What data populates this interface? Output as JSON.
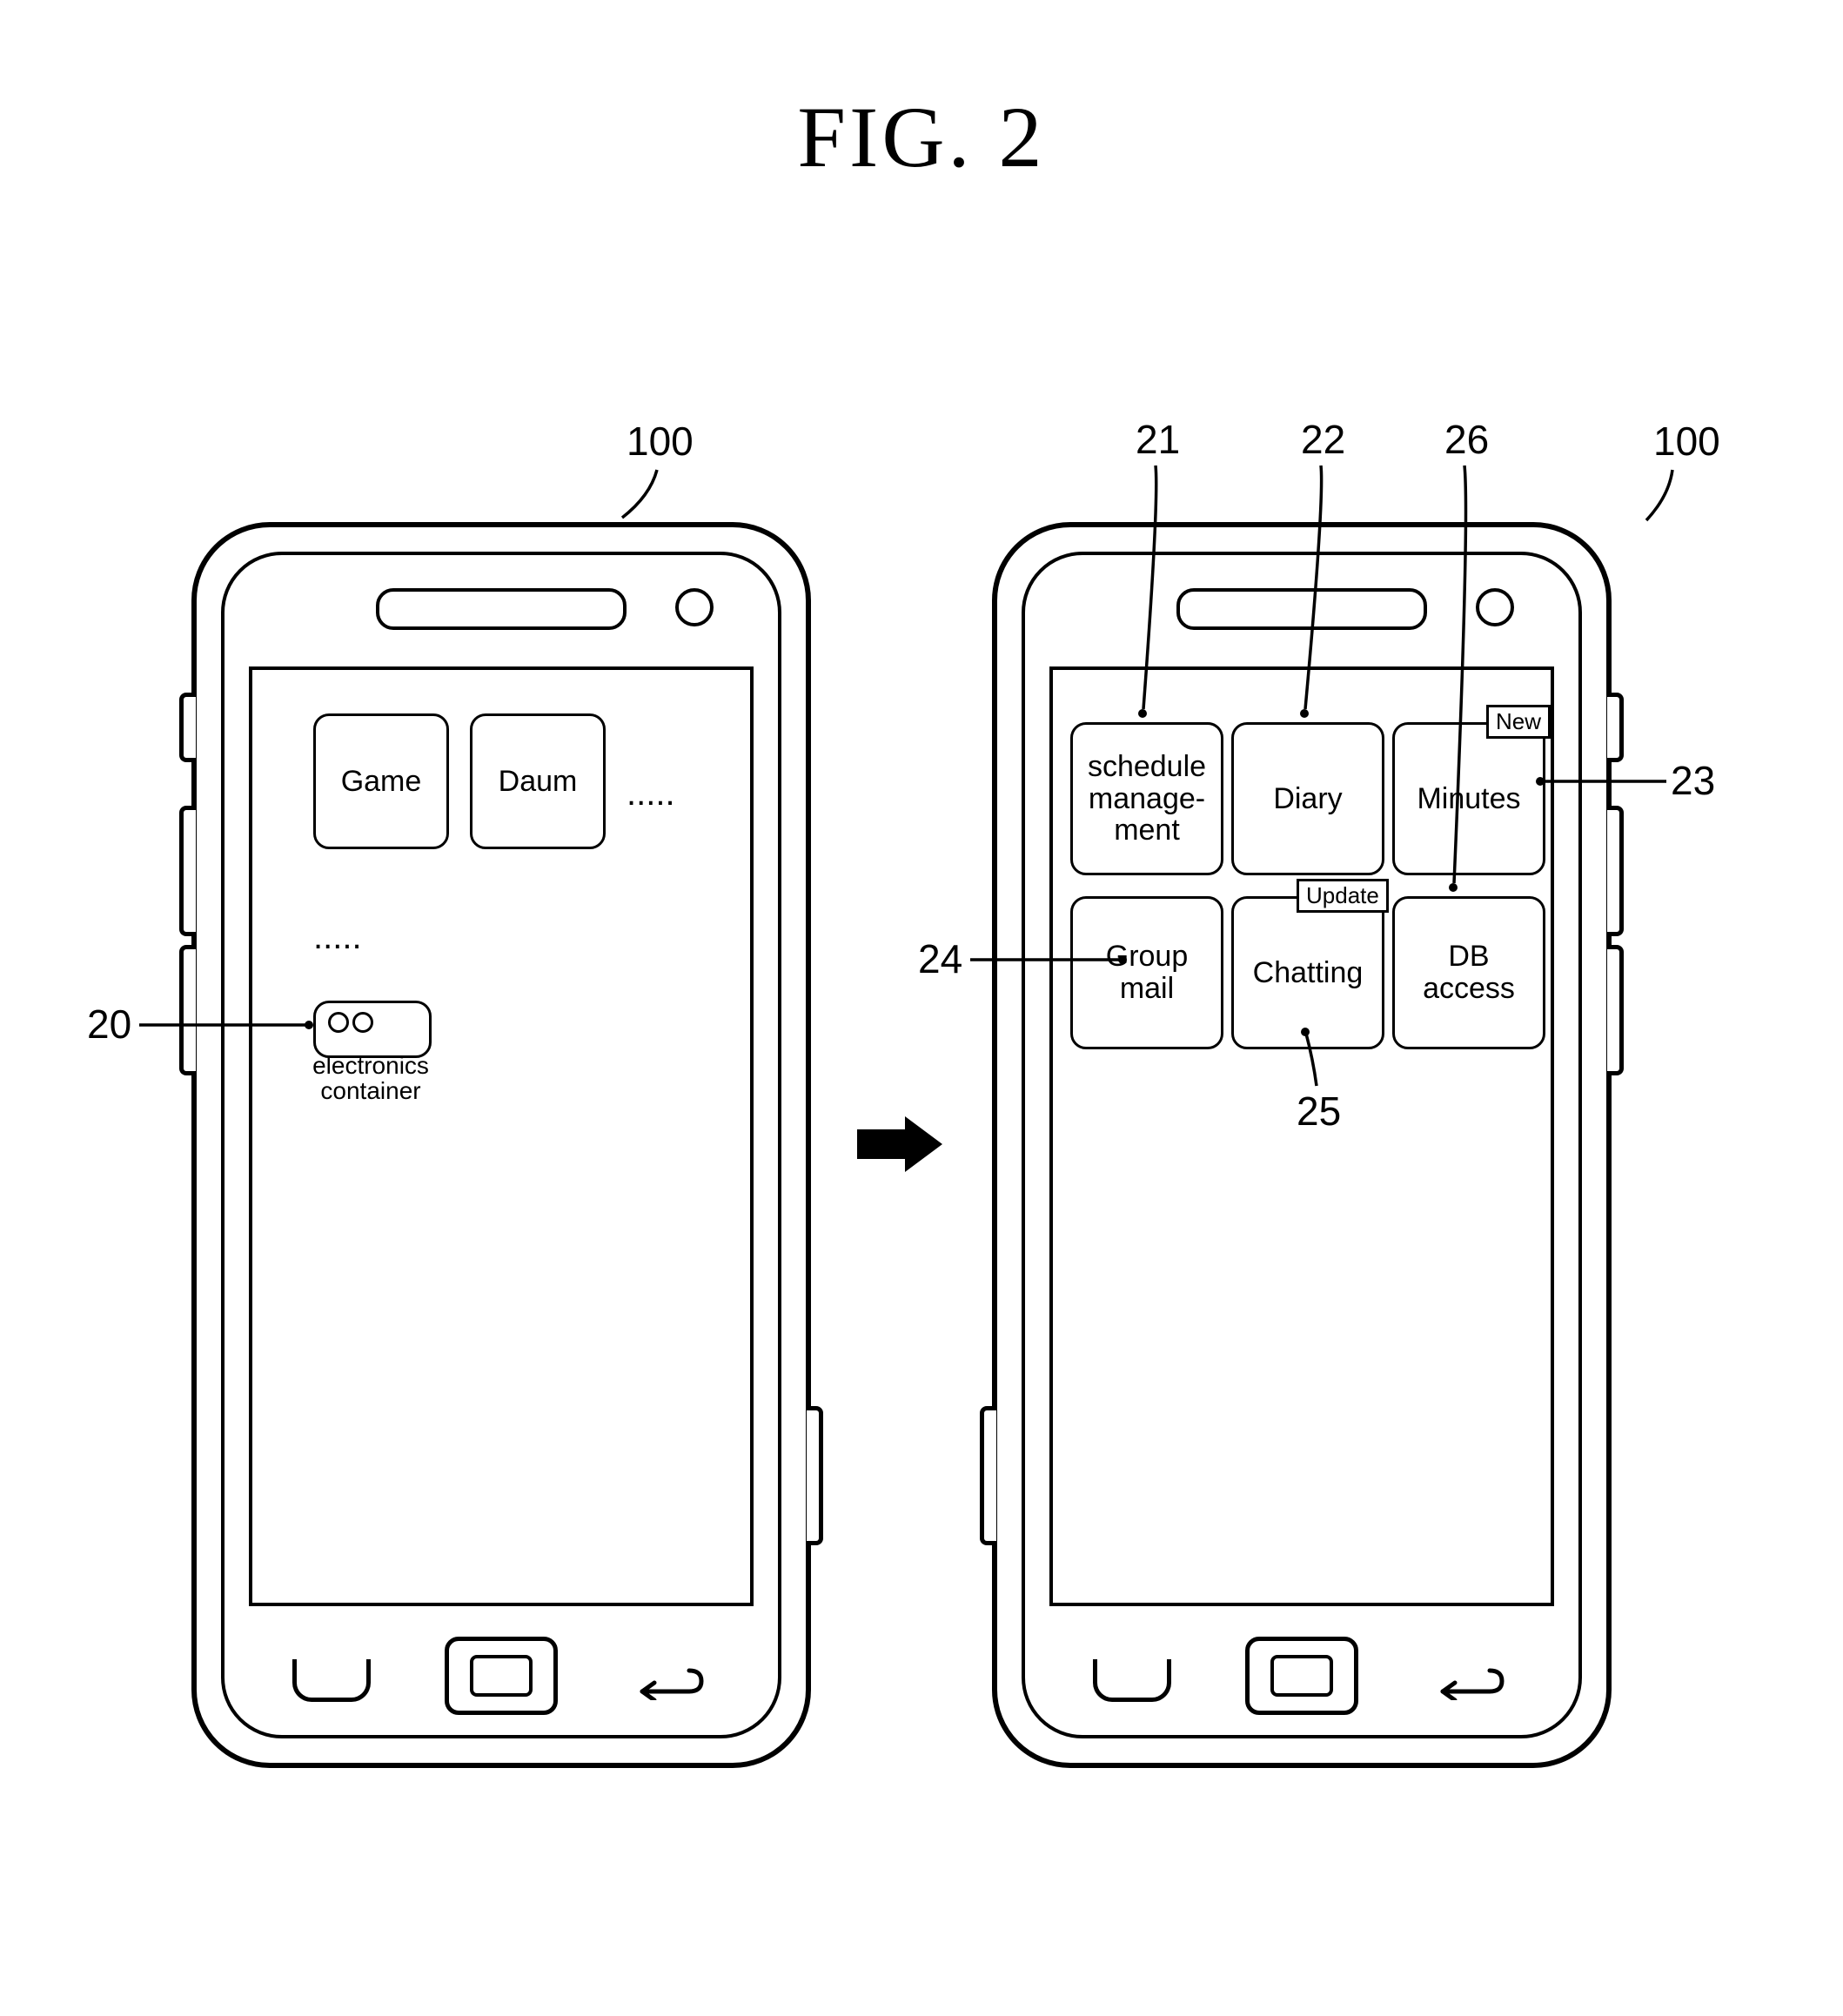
{
  "figure_title": "FIG.  2",
  "left_phone": {
    "ref": "100",
    "row1": {
      "app1": "Game",
      "app2": "Daum",
      "trail": "....."
    },
    "row2_trail": ".....",
    "folder": {
      "line1": "electronics",
      "line2": "container",
      "ref": "20"
    }
  },
  "right_phone": {
    "ref": "100",
    "apps": {
      "21": "schedule\nmanage-\nment",
      "22": "Diary",
      "23": "Minutes",
      "24": "Group\nmail",
      "25": "Chatting",
      "26": "DB access"
    },
    "refs": {
      "r21": "21",
      "r22": "22",
      "r23": "23",
      "r24": "24",
      "r25": "25",
      "r26": "26"
    },
    "tags": {
      "new": "New",
      "update": "Update"
    }
  }
}
